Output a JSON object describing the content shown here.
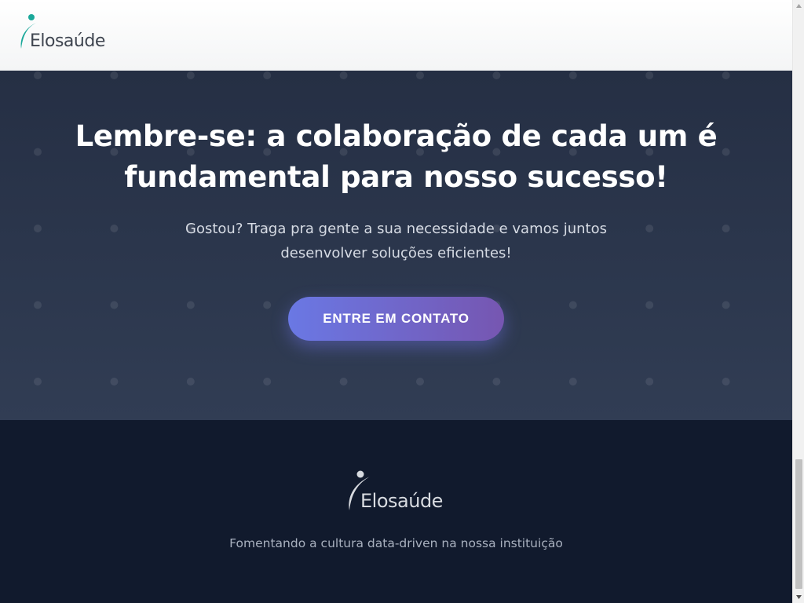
{
  "header": {
    "logo_text": "Elosaúde"
  },
  "cta": {
    "title_line1": "Lembre-se: a colaboração de cada um é",
    "title_line2": "fundamental para nosso sucesso!",
    "subtitle_line1": "Gostou? Traga pra gente a sua necessidade e vamos juntos",
    "subtitle_line2": "desenvolver soluções eficientes!",
    "button_label": "ENTRE EM CONTATO"
  },
  "footer": {
    "logo_text": "Elosaúde",
    "tagline": "Fomentando a cultura data-driven na nossa instituição"
  },
  "colors": {
    "brand_teal": "#1aa89a",
    "cta_bg": "#2a3449",
    "footer_bg": "#111a2d",
    "button_start": "#6a78e4",
    "button_end": "#7656b1"
  },
  "icons": {
    "header_logo": "elosaude-logo-mark",
    "footer_logo": "elosaude-logo-mark"
  }
}
